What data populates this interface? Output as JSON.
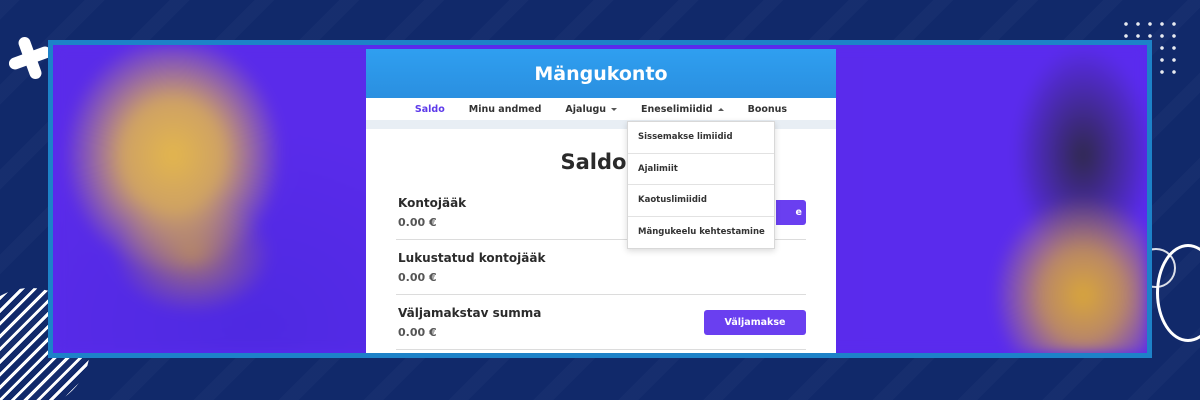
{
  "panel": {
    "title": "Mängukonto"
  },
  "nav": {
    "items": [
      {
        "label": "Saldo"
      },
      {
        "label": "Minu andmed"
      },
      {
        "label": "Ajalugu"
      },
      {
        "label": "Eneselimiidid"
      },
      {
        "label": "Boonus"
      }
    ]
  },
  "dropdown": {
    "items": [
      {
        "label": "Sissemakse limiidid"
      },
      {
        "label": "Ajalimiit"
      },
      {
        "label": "Kaotuslimiidid"
      },
      {
        "label": "Mängukeelu kehtestamine"
      }
    ]
  },
  "balance": {
    "heading": "Saldo",
    "rows": [
      {
        "label": "Kontojääk",
        "value": "0.00 €",
        "button": "e"
      },
      {
        "label": "Lukustatud kontojääk",
        "value": "0.00 €"
      },
      {
        "label": "Väljamakstav summa",
        "value": "0.00 €",
        "button": "Väljamakse"
      }
    ]
  },
  "colors": {
    "background": "#11296a",
    "frame": "#1d82c8",
    "header": "#2f9ff0",
    "accent": "#6a3ff0",
    "active_nav": "#5d3aea"
  }
}
